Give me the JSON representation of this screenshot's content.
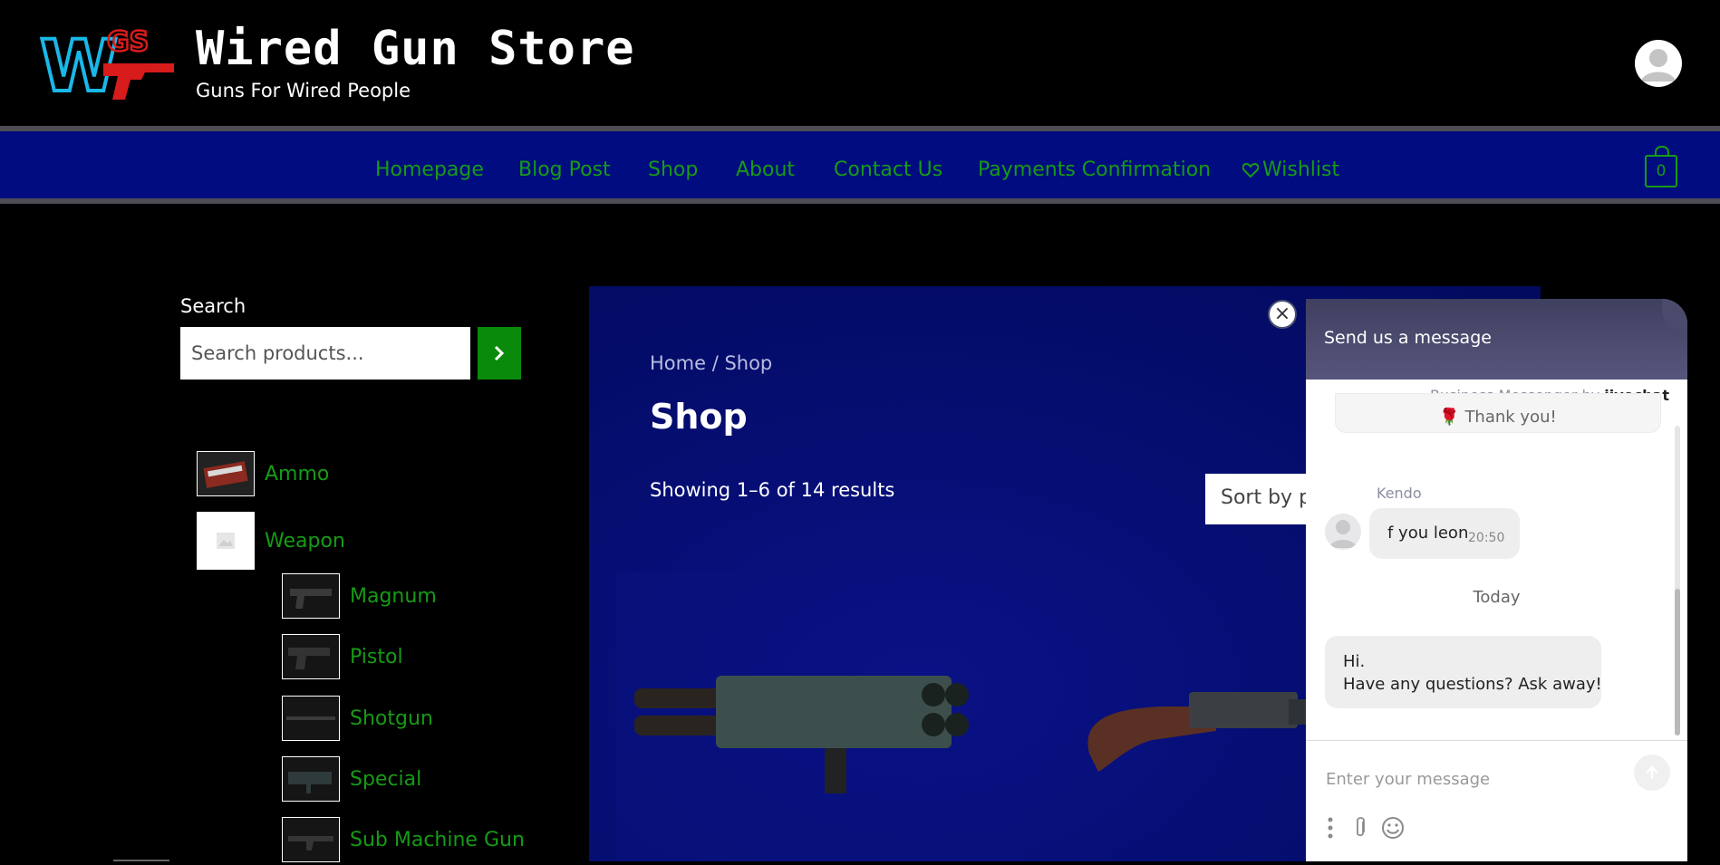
{
  "site": {
    "logo_text": "WGS",
    "title": "Wired Gun Store",
    "tagline": "Guns For Wired People"
  },
  "nav": {
    "items": [
      {
        "label": "Homepage"
      },
      {
        "label": "Blog Post"
      },
      {
        "label": "Shop"
      },
      {
        "label": "About"
      },
      {
        "label": "Contact Us"
      },
      {
        "label": "Payments Confirmation"
      },
      {
        "label": "Wishlist",
        "icon": "heart-icon"
      }
    ],
    "cart_count": "0"
  },
  "sidebar": {
    "search_label": "Search",
    "search_placeholder": "Search products...",
    "categories": [
      {
        "label": "Ammo"
      },
      {
        "label": "Weapon"
      },
      {
        "label": "Magnum"
      },
      {
        "label": "Pistol"
      },
      {
        "label": "Shotgun"
      },
      {
        "label": "Special"
      },
      {
        "label": "Sub Machine Gun"
      }
    ]
  },
  "main": {
    "breadcrumb": "Home / Shop",
    "title": "Shop",
    "result_count": "Showing 1–6 of 14 results",
    "sort_value": "Sort by pr"
  },
  "chat": {
    "header": "Send us a message",
    "powered_prefix": "Business Messenger by ",
    "powered_brand": "jivochat",
    "prev_message": "Thank you!",
    "agent_name": "Kendo",
    "agent_message": "f you leon",
    "agent_time": "20:50",
    "day_separator": "Today",
    "greeting_line1": "Hi.",
    "greeting_line2": "Have any questions? Ask away!",
    "input_placeholder": "Enter your message"
  },
  "colors": {
    "nav_bg": "#000c7f",
    "link_green": "#169b16",
    "search_button": "#0a8a0a",
    "main_bg": "#050d6e",
    "chat_header": "#4a4b6c"
  }
}
